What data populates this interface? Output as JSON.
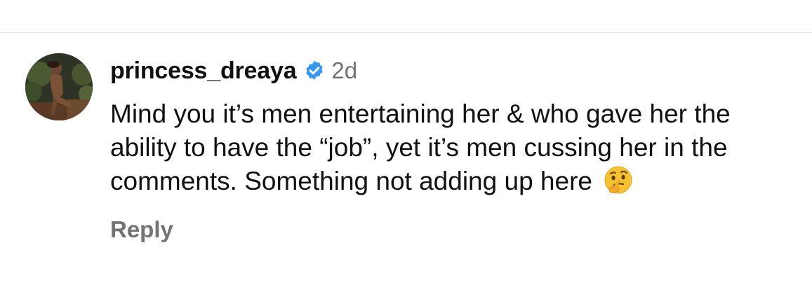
{
  "comment": {
    "username": "princess_dreaya",
    "verified_icon": "verified-badge-icon",
    "time": "2d",
    "text": "Mind you it’s men entertaining her & who gave her the ability to have the “job”, yet it’s men cussing her in the comments. Something not adding up here",
    "emoji_icon": "thinking-face-emoji",
    "reply_label": "Reply"
  },
  "colors": {
    "text_primary": "#111111",
    "text_secondary": "#737373",
    "verified_blue": "#3897f0"
  }
}
